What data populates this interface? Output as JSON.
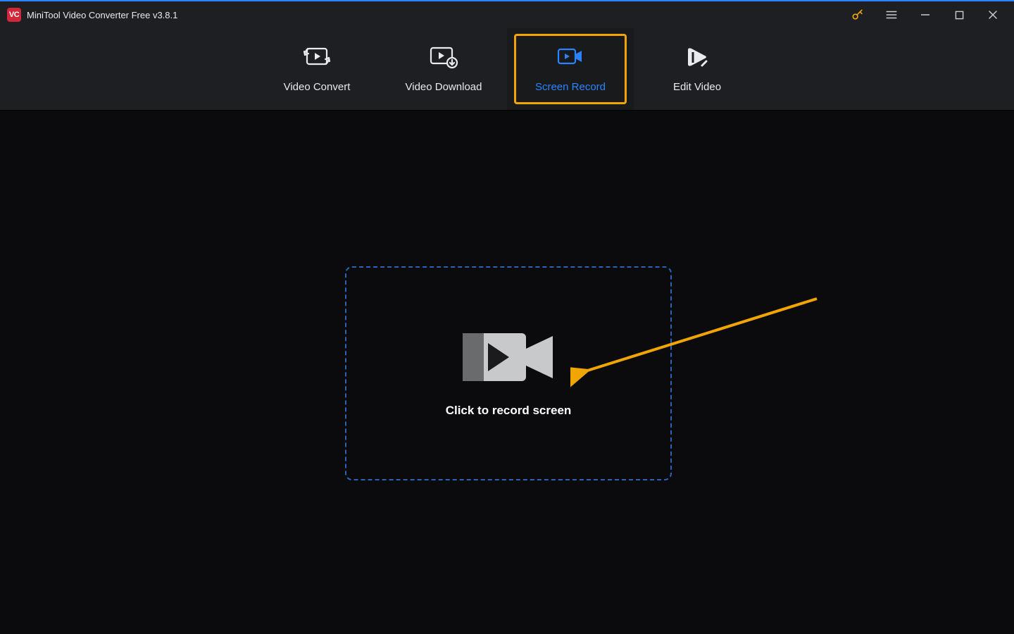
{
  "app": {
    "title": "MiniTool Video Converter Free v3.8.1",
    "badge": "VC"
  },
  "tabs": {
    "convert": "Video Convert",
    "download": "Video Download",
    "record": "Screen Record",
    "edit": "Edit Video",
    "active": "record"
  },
  "main": {
    "cta": "Click to record screen"
  },
  "icons": {
    "key": "key-icon",
    "menu": "hamburger-icon",
    "minimize": "minimize-icon",
    "maximize": "maximize-icon",
    "close": "close-icon"
  },
  "colors": {
    "accent": "#f7b21f",
    "blue": "#2b83ff",
    "badge": "#d1273a"
  }
}
